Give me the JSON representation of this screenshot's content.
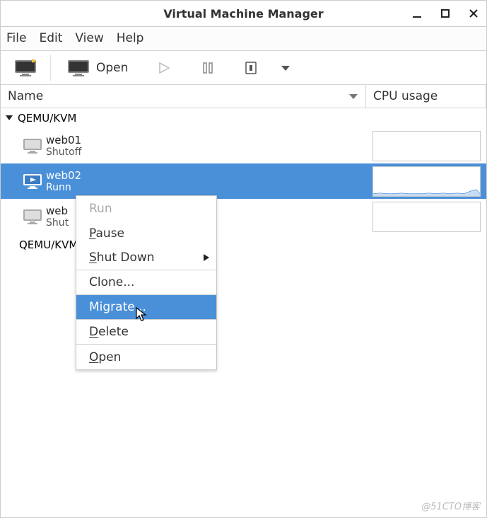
{
  "titlebar": {
    "title": "Virtual Machine Manager"
  },
  "menu": {
    "file": "File",
    "edit": "Edit",
    "view": "View",
    "help": "Help"
  },
  "toolbar": {
    "open": "Open"
  },
  "columns": {
    "name": "Name",
    "cpu": "CPU usage"
  },
  "connections": {
    "primary": "QEMU/KVM",
    "secondary": "QEMU/KVM"
  },
  "vms": [
    {
      "name": "web01",
      "status": "Shutoff"
    },
    {
      "name": "web02",
      "status": "Runn"
    },
    {
      "name": "web",
      "status": "Shut"
    }
  ],
  "context_menu": {
    "run": "Run",
    "pause": "Pause",
    "shutdown": "Shut Down",
    "clone": "Clone...",
    "migrate": "Migrate...",
    "delete": "Delete",
    "open": "Open"
  },
  "watermark": "@51CTO博客"
}
